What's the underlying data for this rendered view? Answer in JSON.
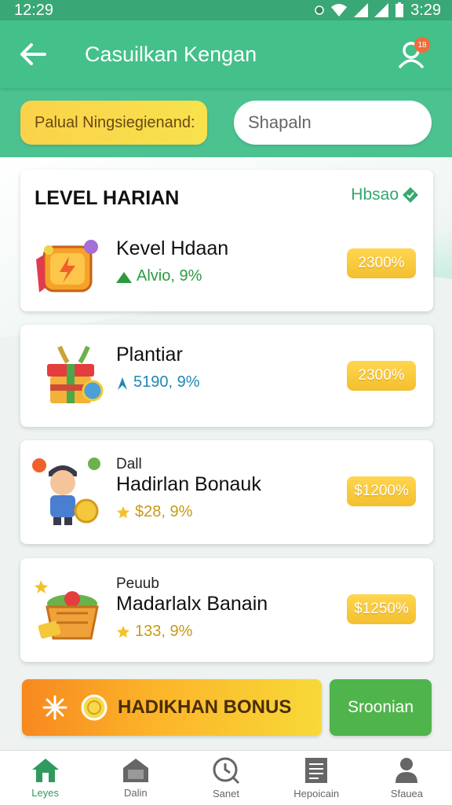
{
  "status_bar": {
    "time_left": "12:29",
    "time_right": "3:29"
  },
  "app_bar": {
    "title": "Casuilkan Kengan",
    "notification_count": "18"
  },
  "promo": {
    "label": "Palual Ningsiegienand:"
  },
  "search": {
    "placeholder": "Shapaln"
  },
  "section": {
    "title": "LEVEL HARIAN",
    "see_all": "Hbsao"
  },
  "items": [
    {
      "subtitle": "",
      "name": "Kevel Hdaan",
      "stat": "Alvio, 9%",
      "stat_color": "green",
      "badge": "2300%",
      "icon": "gift-cube-icon"
    },
    {
      "subtitle": "",
      "name": "Plantiar",
      "stat": "5190, 9%",
      "stat_color": "blue",
      "badge": "2300%",
      "icon": "gift-box-icon"
    },
    {
      "subtitle": "Dall",
      "name": "Hadirlan Bonauk",
      "stat": "$28, 9%",
      "stat_color": "gold",
      "badge": "$1200%",
      "icon": "cartoon-boy-icon"
    },
    {
      "subtitle": "Peuub",
      "name": "Madarlalx Banain",
      "stat": "133, 9%",
      "stat_color": "gold",
      "badge": "$1250%",
      "icon": "treasure-basket-icon"
    }
  ],
  "cta": {
    "bonus_label": "HADIKHAN BONUS",
    "secondary_label": "Sroonian"
  },
  "bottom_nav": [
    {
      "label": "Leyes",
      "icon": "home-icon"
    },
    {
      "label": "Dalin",
      "icon": "store-icon"
    },
    {
      "label": "Sanet",
      "icon": "clock-icon"
    },
    {
      "label": "Hepoicain",
      "icon": "document-icon"
    },
    {
      "label": "Sfauea",
      "icon": "user-icon"
    }
  ],
  "colors": {
    "primary": "#44c08a",
    "accent_gold": "#f3bf2e",
    "cta_orange": "#f7881f",
    "cta_green": "#4fb44c"
  }
}
